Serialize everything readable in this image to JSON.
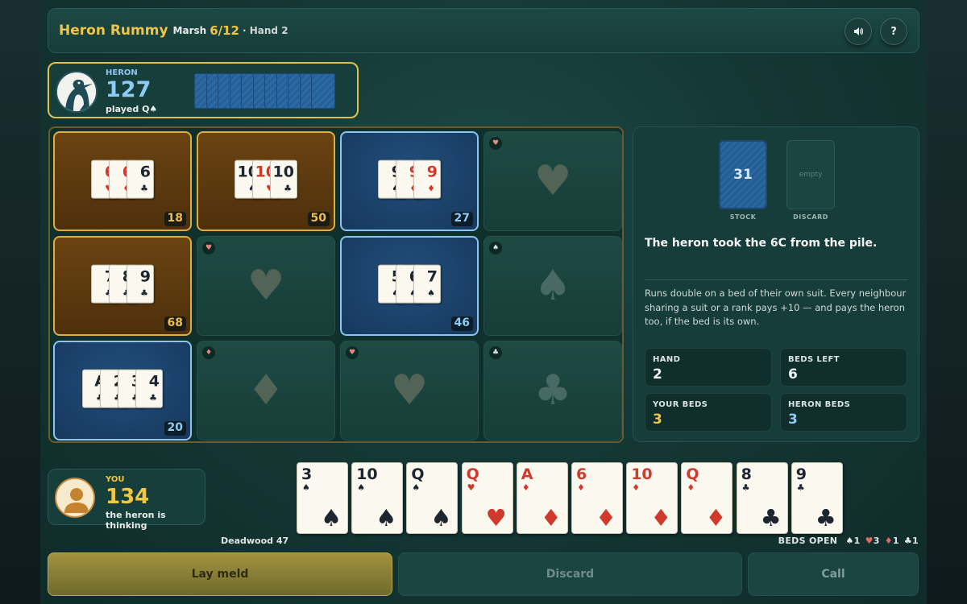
{
  "header": {
    "title": "Heron Rummy",
    "round_label": "Marsh",
    "round_value": "6/12",
    "hand_label": "· Hand 2",
    "sound_icon": "speaker-icon",
    "help_label": "?"
  },
  "heron": {
    "name": "HERON",
    "score": "127",
    "status": "played Q♠",
    "cards_in_hand": 11
  },
  "board": {
    "beds": [
      {
        "style": "wood",
        "cards": [
          {
            "rank": "6",
            "suit": "♥",
            "color": "red"
          },
          {
            "rank": "6",
            "suit": "♦",
            "color": "red"
          },
          {
            "rank": "6",
            "suit": "♣",
            "color": "black"
          }
        ],
        "score": "18"
      },
      {
        "style": "wood",
        "cards": [
          {
            "rank": "10",
            "suit": "♠",
            "color": "black"
          },
          {
            "rank": "10",
            "suit": "♥",
            "color": "red"
          },
          {
            "rank": "10",
            "suit": "♣",
            "color": "black"
          }
        ],
        "score": "50"
      },
      {
        "style": "blue",
        "cards": [
          {
            "rank": "9",
            "suit": "♠",
            "color": "black"
          },
          {
            "rank": "9",
            "suit": "♦",
            "color": "red"
          },
          {
            "rank": "9",
            "suit": "♦",
            "color": "red"
          }
        ],
        "score": "27"
      },
      {
        "style": "empty",
        "suit": "♥",
        "suit_color": "red"
      },
      {
        "style": "wood",
        "cards": [
          {
            "rank": "7",
            "suit": "♣",
            "color": "black"
          },
          {
            "rank": "8",
            "suit": "♣",
            "color": "black"
          },
          {
            "rank": "9",
            "suit": "♣",
            "color": "black"
          }
        ],
        "score": "68"
      },
      {
        "style": "empty",
        "suit": "♥",
        "suit_color": "red"
      },
      {
        "style": "blue",
        "cards": [
          {
            "rank": "5",
            "suit": "♠",
            "color": "black"
          },
          {
            "rank": "6",
            "suit": "♠",
            "color": "black"
          },
          {
            "rank": "7",
            "suit": "♠",
            "color": "black"
          }
        ],
        "score": "46"
      },
      {
        "style": "empty",
        "suit": "♠",
        "suit_color": "black"
      },
      {
        "style": "blue",
        "cards": [
          {
            "rank": "A",
            "suit": "♣",
            "color": "black"
          },
          {
            "rank": "2",
            "suit": "♣",
            "color": "black"
          },
          {
            "rank": "3",
            "suit": "♣",
            "color": "black"
          },
          {
            "rank": "4",
            "suit": "♣",
            "color": "black"
          }
        ],
        "score": "20"
      },
      {
        "style": "empty",
        "suit": "♦",
        "suit_color": "red"
      },
      {
        "style": "empty",
        "suit": "♥",
        "suit_color": "red"
      },
      {
        "style": "empty",
        "suit": "♣",
        "suit_color": "black"
      }
    ]
  },
  "info": {
    "stock_count": "31",
    "stock_label": "STOCK",
    "discard_text": "empty",
    "discard_label": "DISCARD",
    "message": "The heron took the 6C from the pile.",
    "rules": "Runs double on a bed of their own suit. Every neighbour sharing a suit or a rank pays +10 — and pays the heron too, if the bed is its own.",
    "stats": [
      {
        "label": "HAND",
        "value": "2",
        "color": "#f3f5f4"
      },
      {
        "label": "BEDS LEFT",
        "value": "6",
        "color": "#f3f5f4"
      },
      {
        "label": "YOUR BEDS",
        "value": "3",
        "color": "#f2c544"
      },
      {
        "label": "HERON BEDS",
        "value": "3",
        "color": "#8ccbf7"
      }
    ]
  },
  "player": {
    "name": "YOU",
    "score": "134",
    "status": "the heron is thinking"
  },
  "hand": [
    {
      "rank": "3",
      "suit": "♠",
      "color": "black"
    },
    {
      "rank": "10",
      "suit": "♠",
      "color": "black"
    },
    {
      "rank": "Q",
      "suit": "♠",
      "color": "black"
    },
    {
      "rank": "Q",
      "suit": "♥",
      "color": "red"
    },
    {
      "rank": "A",
      "suit": "♦",
      "color": "red"
    },
    {
      "rank": "6",
      "suit": "♦",
      "color": "red"
    },
    {
      "rank": "10",
      "suit": "♦",
      "color": "red"
    },
    {
      "rank": "Q",
      "suit": "♦",
      "color": "red"
    },
    {
      "rank": "8",
      "suit": "♣",
      "color": "black"
    },
    {
      "rank": "9",
      "suit": "♣",
      "color": "black"
    }
  ],
  "footer": {
    "deadwood_label": "Deadwood",
    "deadwood_value": "47",
    "beds_open_label": "BEDS OPEN",
    "beds_open": [
      {
        "suit": "♠",
        "count": "1",
        "color": "black"
      },
      {
        "suit": "♥",
        "count": "3",
        "color": "red"
      },
      {
        "suit": "♦",
        "count": "1",
        "color": "red"
      },
      {
        "suit": "♣",
        "count": "1",
        "color": "black"
      }
    ]
  },
  "actions": {
    "lay_meld": "Lay meld",
    "discard": "Discard",
    "call": "Call"
  }
}
